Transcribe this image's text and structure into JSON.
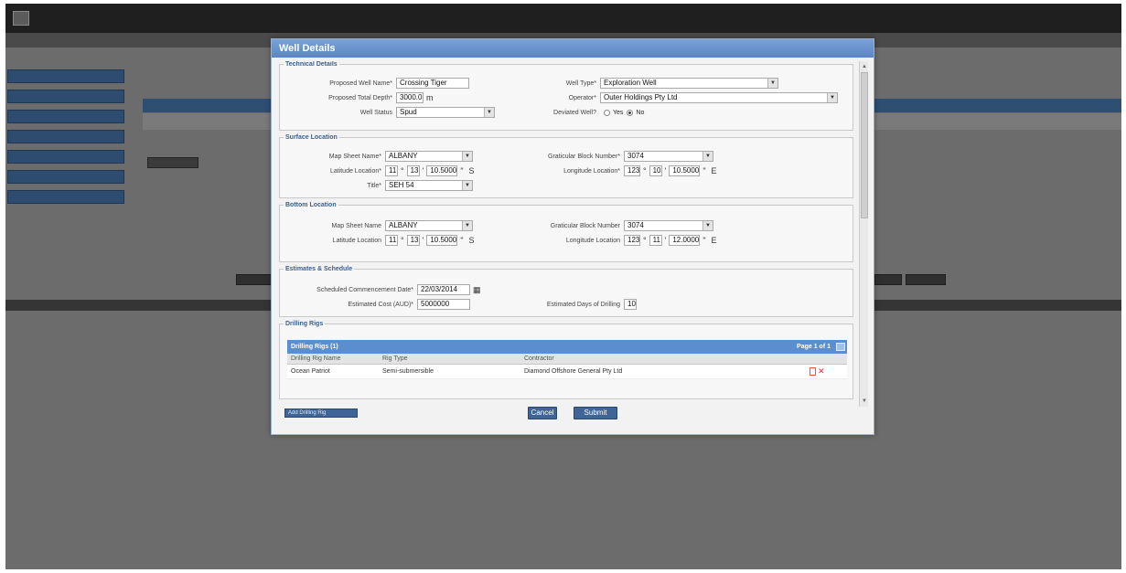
{
  "background": {
    "app_title": "",
    "user_info": "",
    "menu_text": "",
    "side_nav_count": 7,
    "side_text": ""
  },
  "dialog": {
    "title": "Well Details",
    "technical": {
      "legend": "Technical Details",
      "proposed_well_name_label": "Proposed Well Name*",
      "proposed_well_name": "Crossing Tiger",
      "well_type_label": "Well Type*",
      "well_type": "Exploration Well",
      "proposed_total_depth_label": "Proposed Total Depth*",
      "proposed_total_depth": "3000.0",
      "depth_unit": "m",
      "operator_label": "Operator*",
      "operator": "Outer Holdings Pty Ltd",
      "well_status_label": "Well Status",
      "well_status": "Spud",
      "deviated_well_label": "Deviated Well?",
      "deviated_yes": "Yes",
      "deviated_no": "No"
    },
    "surface": {
      "legend": "Surface Location",
      "map_sheet_label": "Map Sheet Name*",
      "map_sheet": "ALBANY",
      "graticular_block_label": "Graticular Block Number*",
      "graticular_block": "3074",
      "latitude_label": "Latitude Location*",
      "lat_deg": "11",
      "lat_min": "13",
      "lat_sec": "10.5000",
      "lat_hem": "S",
      "longitude_label": "Longitude Location*",
      "lon_deg": "123",
      "lon_min": "10",
      "lon_sec": "10.5000",
      "lon_hem": "E",
      "title_label": "Title*",
      "title_value": "SEH 54"
    },
    "bottom": {
      "legend": "Bottom Location",
      "map_sheet_label": "Map Sheet Name",
      "map_sheet": "ALBANY",
      "graticular_block_label": "Graticular Block Number",
      "graticular_block": "3074",
      "latitude_label": "Latitude Location",
      "lat_deg": "11",
      "lat_min": "13",
      "lat_sec": "10.5000",
      "lat_hem": "S",
      "longitude_label": "Longitude Location",
      "lon_deg": "123",
      "lon_min": "11",
      "lon_sec": "12.0000",
      "lon_hem": "E"
    },
    "estimates": {
      "legend": "Estimates & Schedule",
      "commencement_label": "Scheduled Commencement Date*",
      "commencement": "22/03/2014",
      "cost_label": "Estimated Cost (AUD)*",
      "cost": "5000000",
      "days_label": "Estimated Days of Drilling",
      "days": "10"
    },
    "drilling_rigs": {
      "legend": "Drilling Rigs",
      "grid_title": "Drilling Rigs (1)",
      "page_info": "Page 1 of 1",
      "columns": [
        "Drilling Rig Name",
        "Rig Type",
        "Contractor"
      ],
      "rows": [
        {
          "name": "Ocean Patriot",
          "type": "Semi-submersible",
          "contractor": "Diamond Offshore General Pty Ltd"
        }
      ],
      "add_button": "Add Drilling Rig"
    },
    "buttons": {
      "cancel": "Cancel",
      "submit": "Submit"
    }
  }
}
